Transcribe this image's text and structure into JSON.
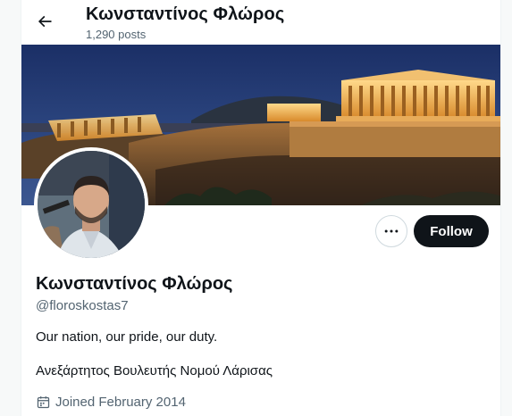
{
  "header": {
    "back_icon": "arrow-left-icon",
    "name": "Κωνσταντίνος Φλώρος",
    "posts_count": "1,290 posts"
  },
  "banner": {
    "description_icon": "acropolis-night-photo"
  },
  "actions": {
    "more_icon": "more-horizontal-icon",
    "follow_label": "Follow"
  },
  "profile": {
    "display_name": "Κωνσταντίνος Φλώρος",
    "handle": "@floroskostas7",
    "bio": [
      "Our nation, our pride, our duty.",
      "Ανεξάρτητος Βουλευτής Νομού Λάρισας"
    ],
    "joined_icon": "calendar-icon",
    "joined": "Joined February 2014"
  },
  "colors": {
    "text_primary": "#0f1419",
    "text_secondary": "#536471",
    "button_dark": "#0f1419",
    "border": "#cfd9de"
  }
}
